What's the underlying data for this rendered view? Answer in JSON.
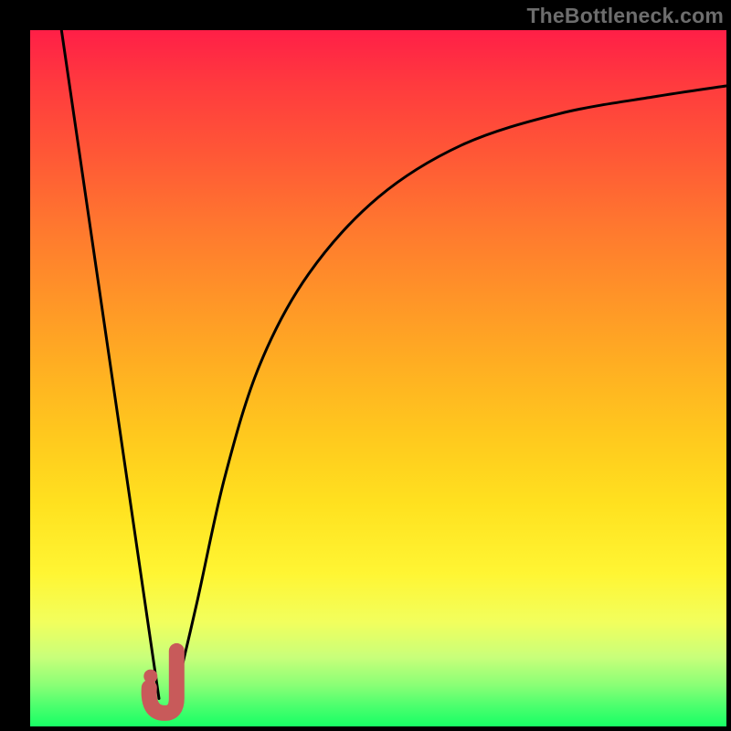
{
  "watermark": "TheBottleneck.com",
  "colors": {
    "frame": "#000000",
    "curve": "#000000",
    "marker_stroke": "#c85a5a",
    "marker_fill": "#c85a5a"
  },
  "chart_data": {
    "type": "line",
    "title": "",
    "xlabel": "",
    "ylabel": "",
    "xlim": [
      0,
      100
    ],
    "ylim": [
      0,
      100
    ],
    "grid": false,
    "legend": false,
    "series": [
      {
        "name": "left-branch",
        "x": [
          4.5,
          18.5
        ],
        "y": [
          100,
          4
        ]
      },
      {
        "name": "right-branch",
        "x": [
          20.5,
          24,
          28,
          33,
          40,
          50,
          62,
          76,
          90,
          100
        ],
        "y": [
          3,
          18,
          36,
          52,
          65,
          76,
          83.5,
          88,
          90.5,
          92
        ]
      }
    ],
    "marker": {
      "shape": "J",
      "center_x": 19.2,
      "center_y": 4.8,
      "dot_x": 17.3,
      "dot_y": 7.2
    }
  }
}
